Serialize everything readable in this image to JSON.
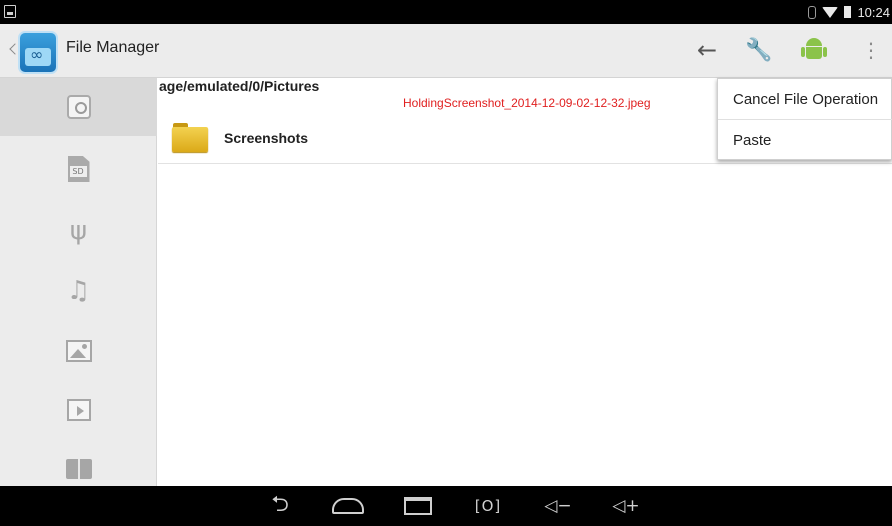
{
  "status_bar": {
    "time": "10:24"
  },
  "action_bar": {
    "title": "File Manager",
    "actions": [
      "back-arrow-icon",
      "wrench-icon",
      "android-icon",
      "overflow-menu-icon"
    ]
  },
  "sidebar": {
    "items": [
      {
        "icon": "internal-storage-icon",
        "active": true
      },
      {
        "icon": "sd-card-icon",
        "label": "SD"
      },
      {
        "icon": "usb-icon"
      },
      {
        "icon": "music-icon"
      },
      {
        "icon": "picture-icon"
      },
      {
        "icon": "video-icon"
      },
      {
        "icon": "book-icon"
      }
    ]
  },
  "content": {
    "path": "age/emulated/0/Pictures",
    "clipboard_file": "HoldingScreenshot_2014-12-09-02-12-32.jpeg",
    "items": [
      {
        "name": "Screenshots",
        "type": "folder"
      }
    ]
  },
  "overflow_menu": {
    "items": [
      "Cancel File Operation",
      "Paste"
    ]
  },
  "nav_bar": {
    "buttons": [
      "back-icon",
      "home-icon",
      "recents-icon",
      "screenshot-icon",
      "volume-down-icon",
      "volume-up-icon"
    ],
    "screenshot_glyph": "[O]",
    "vol_down_glyph": "◁−",
    "vol_up_glyph": "◁+"
  },
  "colors": {
    "clipboard_text": "#e02020",
    "folder": "#e6b52a",
    "android": "#8bc34a"
  }
}
